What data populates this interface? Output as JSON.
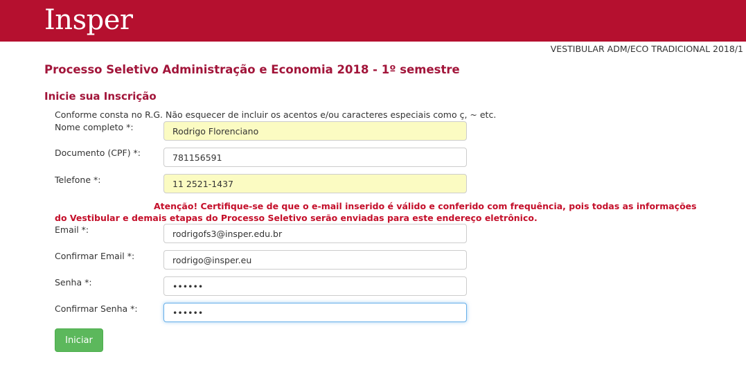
{
  "header": {
    "logo_text": "Insper",
    "brand_color": "#b5102f"
  },
  "exam_label": "VESTIBULAR ADM/ECO TRADICIONAL 2018/1",
  "page_title": "Processo Seletivo Administração e Economia 2018 - 1º semestre",
  "section_title": "Inicie sua Inscrição",
  "form": {
    "name_hint": "Conforme consta no R.G. Não esquecer de incluir os acentos e/ou caracteres especiais como ç, ~ etc.",
    "name": {
      "label": "Nome completo *:",
      "value": "Rodrigo Florenciano"
    },
    "cpf": {
      "label": "Documento (CPF) *:",
      "value": "781156591"
    },
    "phone": {
      "label": "Telefone *:",
      "value": "11 2521-1437"
    },
    "warning_line1": "Atenção! Certifique-se de que o e-mail inserido é válido e conferido com frequência, pois todas as informações",
    "warning_line2": "do Vestibular e demais etapas do Processo Seletivo serão enviadas para este endereço eletrônico.",
    "email": {
      "label": "Email *:",
      "value": "rodrigofs3@insper.edu.br"
    },
    "confirm_email": {
      "label": "Confirmar Email *:",
      "value": "rodrigo@insper.eu"
    },
    "password": {
      "label": "Senha *:",
      "value": "••••••"
    },
    "confirm_password": {
      "label": "Confirmar Senha *:",
      "value": "••••••"
    },
    "submit_label": "Iniciar"
  },
  "colors": {
    "title": "#a2153a",
    "warning": "#c40f2a",
    "submit": "#5cb85c",
    "autofill": "#fbfbc2"
  }
}
